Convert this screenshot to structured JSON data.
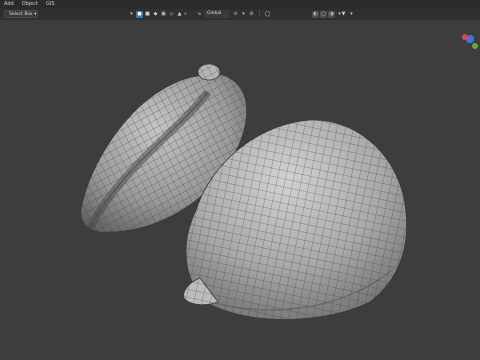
{
  "menubar": {
    "items": [
      "Add",
      "Object",
      "GIS"
    ]
  },
  "toolbar": {
    "select_mode": "Select Box",
    "transform_orientation": "Global"
  },
  "gizmo": {
    "x_color": "#e0454e",
    "y_color": "#6aa33a",
    "z_color": "#3c77d6"
  },
  "colors": {
    "background": "#3d3d3d",
    "menubar": "#2b2b2b",
    "accent": "#4772b3",
    "mesh_fill": "#9b9b9b",
    "wire": "#3a3a3a"
  }
}
